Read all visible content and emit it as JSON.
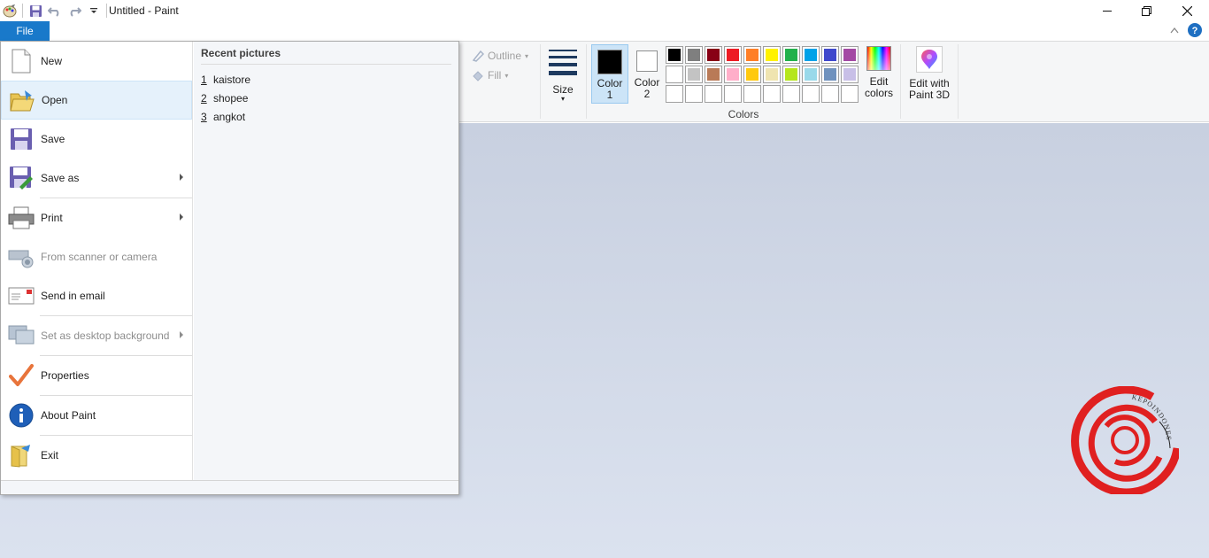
{
  "window": {
    "title": "Untitled - Paint",
    "controls": [
      "minimize",
      "maximize",
      "close"
    ]
  },
  "quick_access": {
    "icons": [
      "paint-app-icon",
      "save-icon",
      "undo-icon",
      "redo-icon",
      "customize-dropdown-icon"
    ]
  },
  "file_tab": {
    "label": "File"
  },
  "file_menu": {
    "items": [
      {
        "label": "New",
        "icon": "new-document-icon",
        "submenu": false,
        "enabled": true
      },
      {
        "label": "Open",
        "icon": "open-folder-icon",
        "submenu": false,
        "enabled": true,
        "highlighted": true
      },
      {
        "label": "Save",
        "icon": "save-icon",
        "submenu": false,
        "enabled": true
      },
      {
        "label": "Save as",
        "icon": "save-as-icon",
        "submenu": true,
        "enabled": true
      },
      {
        "label": "Print",
        "icon": "printer-icon",
        "submenu": true,
        "enabled": true
      },
      {
        "label": "From scanner or camera",
        "icon": "scanner-icon",
        "submenu": false,
        "enabled": false
      },
      {
        "label": "Send in email",
        "icon": "email-icon",
        "submenu": false,
        "enabled": true
      },
      {
        "label": "Set as desktop background",
        "icon": "desktop-icon",
        "submenu": true,
        "enabled": false
      },
      {
        "label": "Properties",
        "icon": "checkmark-icon",
        "submenu": false,
        "enabled": true
      },
      {
        "label": "About Paint",
        "icon": "info-icon",
        "submenu": false,
        "enabled": true
      },
      {
        "label": "Exit",
        "icon": "exit-icon",
        "submenu": false,
        "enabled": true
      }
    ],
    "recent": {
      "title": "Recent pictures",
      "items": [
        {
          "num": "1",
          "name": "kaistore"
        },
        {
          "num": "2",
          "name": "shopee"
        },
        {
          "num": "3",
          "name": "angkot"
        }
      ]
    }
  },
  "ribbon": {
    "outline_label": "Outline",
    "fill_label": "Fill",
    "size_label": "Size",
    "color1_label_a": "Color",
    "color1_label_b": "1",
    "color2_label_a": "Color",
    "color2_label_b": "2",
    "color1_value": "#000000",
    "color2_value": "#ffffff",
    "colors_group_label": "Colors",
    "palette_row1": [
      "#000000",
      "#7f7f7f",
      "#880015",
      "#ed1c24",
      "#ff7f27",
      "#fff200",
      "#22b14c",
      "#00a2e8",
      "#3f48cc",
      "#a349a4"
    ],
    "palette_row2": [
      "#ffffff",
      "#c3c3c3",
      "#b97a57",
      "#ffaec9",
      "#ffc90e",
      "#efe4b0",
      "#b5e61d",
      "#99d9ea",
      "#7092be",
      "#c8bfe7"
    ],
    "palette_row3": [
      "",
      "",
      "",
      "",
      "",
      "",
      "",
      "",
      "",
      ""
    ],
    "edit_colors_a": "Edit",
    "edit_colors_b": "colors",
    "paint3d_a": "Edit with",
    "paint3d_b": "Paint 3D"
  },
  "watermark": {
    "text": "KEPOINDONESIA"
  }
}
